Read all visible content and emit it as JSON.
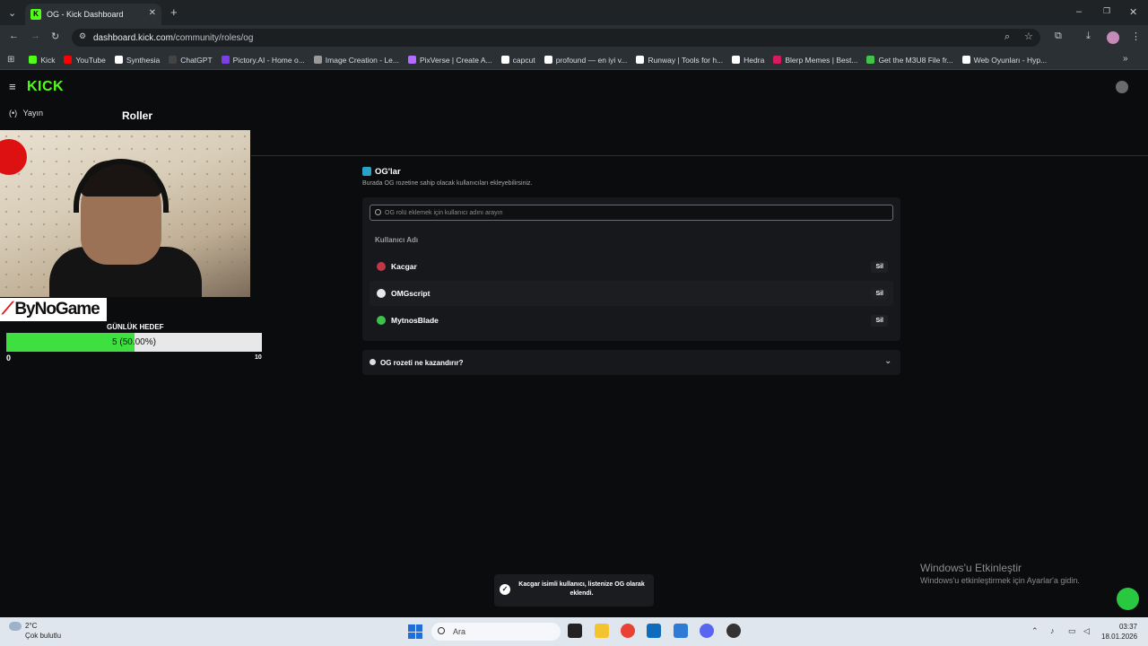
{
  "browser": {
    "tab_title": "OG - Kick Dashboard",
    "tab_favicon": "K",
    "url_host": "dashboard.kick.com",
    "url_path": "/community/roles/og",
    "bookmarks": [
      {
        "label": "Kick",
        "color": "#53fc18"
      },
      {
        "label": "YouTube",
        "color": "#ff0000"
      },
      {
        "label": "Synthesia",
        "color": "#ffffff"
      },
      {
        "label": "ChatGPT",
        "color": "#444444"
      },
      {
        "label": "Pictory.AI - Home o...",
        "color": "#7b3fe4"
      },
      {
        "label": "Image Creation - Le...",
        "color": "#999999"
      },
      {
        "label": "PixVerse | Create A...",
        "color": "#b36cff"
      },
      {
        "label": "capcut",
        "color": "#ffffff"
      },
      {
        "label": "profound — en iyi v...",
        "color": "#ffffff"
      },
      {
        "label": "Runway | Tools for h...",
        "color": "#ffffff"
      },
      {
        "label": "Hedra",
        "color": "#ffffff"
      },
      {
        "label": "Blerp Memes | Best...",
        "color": "#d81b60"
      },
      {
        "label": "Get the M3U8 File fr...",
        "color": "#43c34a"
      },
      {
        "label": "Web Oyunları - Hyp...",
        "color": "#ffffff"
      }
    ]
  },
  "kick": {
    "logo": "KICK",
    "logo_color": "#53fc18",
    "nav_item": "Yayın",
    "page_title": "Roller"
  },
  "stream_overlay": {
    "brand": "ByNoGame",
    "goal_label": "GÜNLÜK HEDEF",
    "goal_text": "5 (50.00%)",
    "goal_progress": 0.5,
    "goal_min": "0",
    "goal_max": "10"
  },
  "og_section": {
    "title": "OG'lar",
    "description": "Burada OG rozetine sahip olacak kullanıcıları ekleyebilirsiniz.",
    "search_placeholder": "OG rolü eklemek için kullanıcı adını arayın",
    "column_header": "Kullanıcı Adı",
    "users": [
      {
        "name": "Kacgar",
        "action": "Sil",
        "avatar_color": "#c0354a"
      },
      {
        "name": "OMGscript",
        "action": "Sil",
        "avatar_color": "#e8e8e8"
      },
      {
        "name": "MytnosBlade",
        "action": "Sil",
        "avatar_color": "#3cc24a"
      }
    ],
    "faq_label": "OG rozeti ne kazandırır?"
  },
  "toast": {
    "message": "Kacgar isimli kullanıcı, listenize OG olarak eklendi."
  },
  "watermark": {
    "line1": "Windows'u Etkinleştir",
    "line2": "Windows'u etkinleştirmek için Ayarlar'a gidin."
  },
  "taskbar": {
    "weather_temp": "2°C",
    "weather_desc": "Çok bulutlu",
    "search_placeholder": "Ara",
    "time": "03:37",
    "date": "18.01.2026"
  }
}
